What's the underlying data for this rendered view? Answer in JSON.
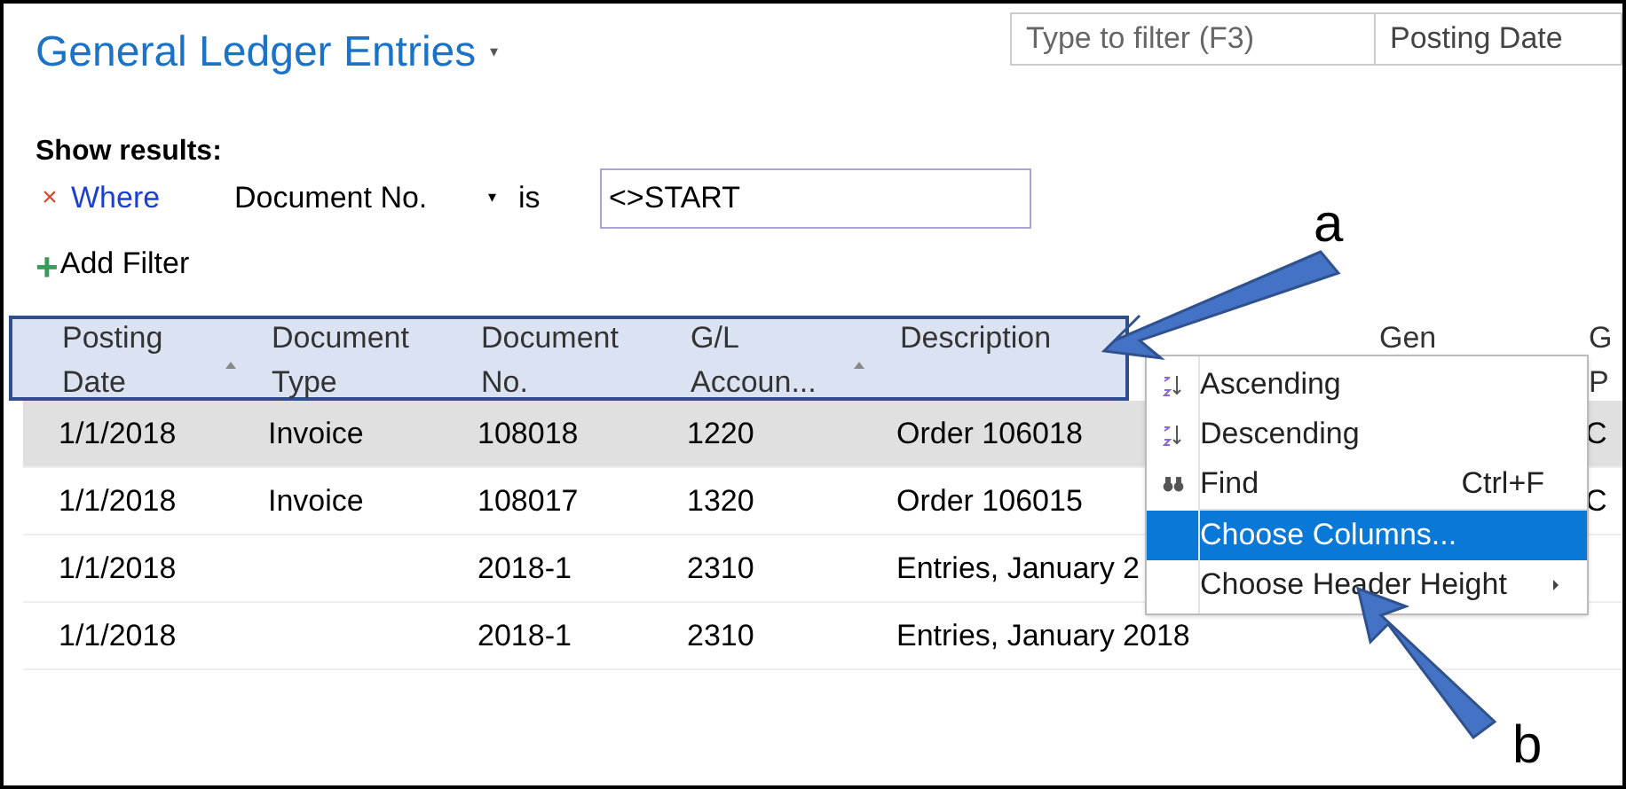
{
  "page": {
    "title": "General Ledger Entries",
    "title_caret": "▾"
  },
  "search": {
    "placeholder": "Type to filter (F3)",
    "sort_field": "Posting Date"
  },
  "filter": {
    "heading": "Show results:",
    "remove": "×",
    "where": "Where",
    "field": "Document No.",
    "field_caret": "▾",
    "operator": "is",
    "value": "<>START",
    "add_icon": "+",
    "add_label": "Add Filter"
  },
  "table": {
    "columns": [
      {
        "label": [
          "Posting",
          "Date"
        ],
        "sorted": true
      },
      {
        "label": [
          "Document",
          "Type"
        ],
        "sorted": false
      },
      {
        "label": [
          "Document",
          "No."
        ],
        "sorted": false
      },
      {
        "label": [
          "G/L",
          "Accoun..."
        ],
        "sorted": true
      },
      {
        "label": [
          "Description"
        ]
      },
      {
        "label": [
          "Gen"
        ]
      },
      {
        "label": [
          "G",
          "P"
        ]
      }
    ],
    "rows": [
      {
        "cells": [
          "1/1/2018",
          "Invoice",
          "108018",
          "1220",
          "Order 106018",
          "",
          "C"
        ],
        "selected": true
      },
      {
        "cells": [
          "1/1/2018",
          "Invoice",
          "108017",
          "1320",
          "Order 106015",
          "",
          "C"
        ],
        "selected": false
      },
      {
        "cells": [
          "1/1/2018",
          "",
          "2018-1",
          "2310",
          "Entries, January 2",
          "",
          ""
        ],
        "selected": false
      },
      {
        "cells": [
          "1/1/2018",
          "",
          "2018-1",
          "2310",
          "Entries, January 2018",
          "",
          ""
        ],
        "selected": false
      }
    ]
  },
  "context_menu": {
    "items": [
      {
        "kind": "sort-up",
        "label": "Ascending",
        "selected": false
      },
      {
        "kind": "sort-down",
        "label": "Descending",
        "selected": false
      },
      {
        "kind": "find",
        "label": "Find",
        "shortcut": "Ctrl+F",
        "selected": false
      },
      {
        "kind": "plain",
        "label": "Choose Columns...",
        "selected": true
      },
      {
        "kind": "submenu",
        "label": "Choose Header Height",
        "selected": false
      }
    ]
  },
  "annotations": [
    {
      "label": "a"
    },
    {
      "label": "b"
    }
  ]
}
